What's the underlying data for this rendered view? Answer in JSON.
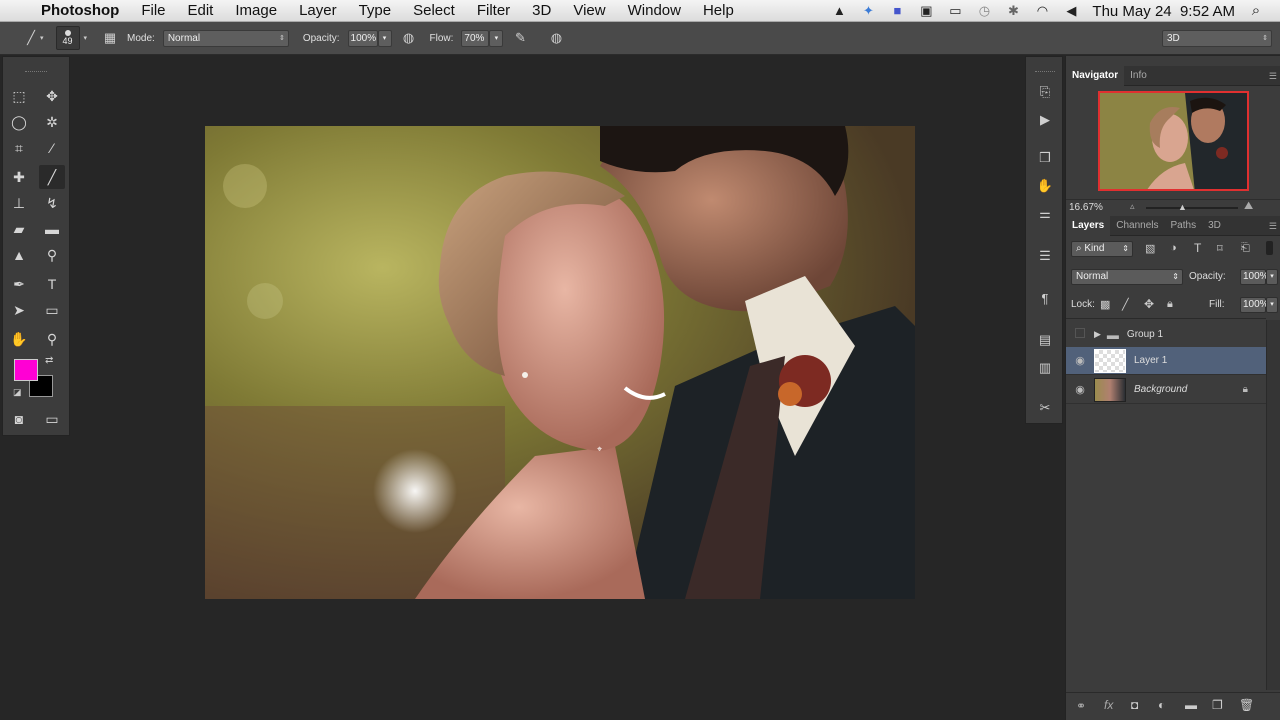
{
  "menubar": {
    "apple_icon": "apple-icon",
    "app_name": "Photoshop",
    "items": [
      "File",
      "Edit",
      "Image",
      "Layer",
      "Type",
      "Select",
      "Filter",
      "3D",
      "View",
      "Window",
      "Help"
    ],
    "clock": "Thu May 24  9:52 AM"
  },
  "options": {
    "brush_size": "49",
    "mode_label": "Mode:",
    "mode_value": "Normal",
    "opacity_label": "Opacity:",
    "opacity_value": "100%",
    "flow_label": "Flow:",
    "flow_value": "70%",
    "workspace": "3D"
  },
  "colors": {
    "foreground": "#ff00d4",
    "background": "#000000",
    "selection": "#51617a",
    "navigator_frame": "#e03030"
  },
  "navigator": {
    "tabs": [
      "Navigator",
      "Info"
    ],
    "zoom": "16.67%"
  },
  "layers_panel": {
    "tabs": [
      "Layers",
      "Channels",
      "Paths",
      "3D"
    ],
    "kind_label": "Kind",
    "blend_mode": "Normal",
    "opacity_label": "Opacity:",
    "opacity_value": "100%",
    "lock_label": "Lock:",
    "fill_label": "Fill:",
    "fill_value": "100%",
    "layers": [
      {
        "name": "Group 1"
      },
      {
        "name": "Layer 1"
      },
      {
        "name": "Background"
      }
    ]
  }
}
